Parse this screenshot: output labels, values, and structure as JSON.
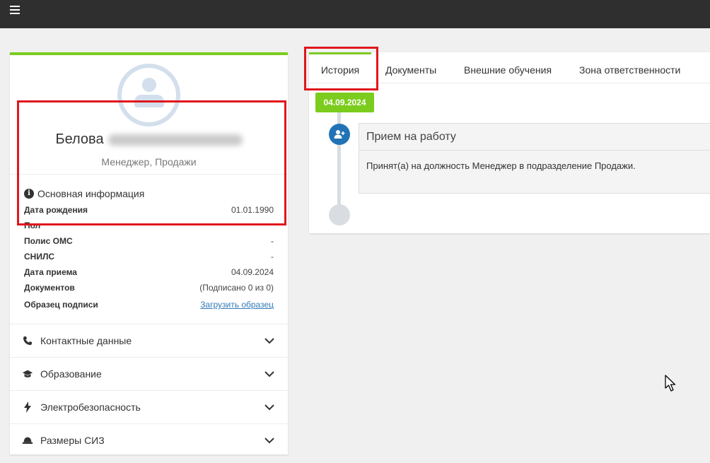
{
  "employee": {
    "surname": "Белова",
    "position": "Менеджер, Продажи"
  },
  "info": {
    "title": "Основная информация",
    "rows": [
      {
        "label": "Дата рождения",
        "value": "01.01.1990"
      },
      {
        "label": "Пол",
        "value": ""
      },
      {
        "label": "Полис ОМС",
        "value": "-"
      },
      {
        "label": "СНИЛС",
        "value": "-"
      },
      {
        "label": "Дата приема",
        "value": "04.09.2024"
      },
      {
        "label": "Документов",
        "value": "(Подписано 0 из 0)"
      },
      {
        "label": "Образец подписи",
        "link": "Загрузить образец"
      }
    ]
  },
  "accordion": [
    {
      "label": "Контактные данные",
      "icon": "phone-icon"
    },
    {
      "label": "Образование",
      "icon": "graduation-cap-icon"
    },
    {
      "label": "Электробезопасность",
      "icon": "lightning-icon"
    },
    {
      "label": "Размеры СИЗ",
      "icon": "hard-hat-icon"
    }
  ],
  "tabs": [
    {
      "label": "История",
      "active": true
    },
    {
      "label": "Документы"
    },
    {
      "label": "Внешние обучения"
    },
    {
      "label": "Зона ответственности"
    }
  ],
  "timeline": {
    "date": "04.09.2024",
    "event_title": "Прием на работу",
    "event_text": "Принят(а) на должность Менеджер в подразделение Продажи."
  },
  "colors": {
    "accent": "#7ccc1e",
    "timeline_icon": "#2173b6",
    "highlight": "#e0161d",
    "topbar": "#2f2f2f"
  }
}
